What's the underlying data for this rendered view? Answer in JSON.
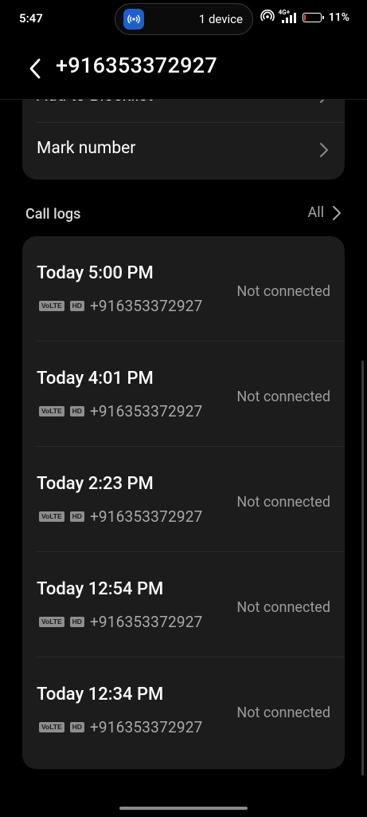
{
  "status_bar": {
    "time": "5:47",
    "activity_text": "1 device",
    "activity_icon": "nfc-broadcast-icon",
    "network_label": "4G+",
    "battery_percent": "11%",
    "battery_level": 0.11,
    "battery_color": "#e5484d"
  },
  "header": {
    "back_icon": "chevron-left-icon",
    "title": "+916353372927"
  },
  "top_card": {
    "items": [
      {
        "label": "Add to Blocklist"
      },
      {
        "label": "Mark number"
      }
    ]
  },
  "call_logs": {
    "title": "Call logs",
    "all_label": "All",
    "entries": [
      {
        "time": "Today 5:00 PM",
        "tag1": "VoLTE",
        "tag2": "HD",
        "number": "+916353372927",
        "status": "Not connected"
      },
      {
        "time": "Today 4:01 PM",
        "tag1": "VoLTE",
        "tag2": "HD",
        "number": "+916353372927",
        "status": "Not connected"
      },
      {
        "time": "Today 2:23 PM",
        "tag1": "VoLTE",
        "tag2": "HD",
        "number": "+916353372927",
        "status": "Not connected"
      },
      {
        "time": "Today 12:54 PM",
        "tag1": "VoLTE",
        "tag2": "HD",
        "number": "+916353372927",
        "status": "Not connected"
      },
      {
        "time": "Today 12:34 PM",
        "tag1": "VoLTE",
        "tag2": "HD",
        "number": "+916353372927",
        "status": "Not connected"
      }
    ]
  },
  "colors": {
    "background": "#000000",
    "card": "#1c1c1c",
    "secondary_text": "#a9a9a9"
  }
}
